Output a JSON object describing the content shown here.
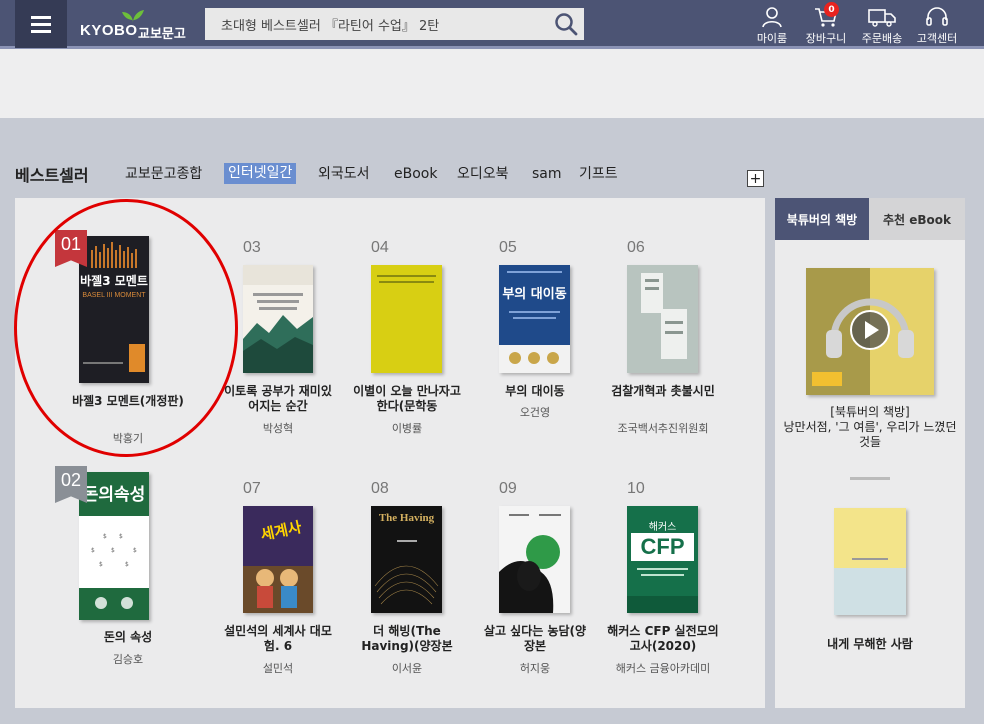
{
  "header": {
    "logo_text": "KYOBO",
    "logo_kr": "교보문고",
    "search_value": "초대형 베스트셀러 『라틴어 수업』 2탄",
    "util": [
      {
        "label": "마이룸",
        "icon": "user-icon"
      },
      {
        "label": "장바구니",
        "icon": "cart-icon",
        "badge": "0"
      },
      {
        "label": "주문배송",
        "icon": "truck-icon"
      },
      {
        "label": "고객센터",
        "icon": "headset-icon"
      }
    ]
  },
  "bestseller": {
    "title": "베스트셀러",
    "tabs": [
      "교보문고종합",
      "인터넷일간",
      "외국도서",
      "eBook",
      "오디오북",
      "sam",
      "기프트"
    ],
    "active_tab": "인터넷일간",
    "plus": "+",
    "books": [
      {
        "rank": "01",
        "title": "바젤3 모멘트(개정판)",
        "author": "박홍기",
        "cover_title": "바젤3 모멘트",
        "cover_sub": "BASEL III MOMENT"
      },
      {
        "rank": "02",
        "title": "돈의 속성",
        "author": "김승호",
        "cover_title": "돈의속성"
      },
      {
        "rank": "03",
        "title": "이토록 공부가 재미있어지는 순간",
        "author": "박성혁"
      },
      {
        "rank": "04",
        "title": "이별이 오늘 만나자고 한다(문학동",
        "author": "이병률"
      },
      {
        "rank": "05",
        "title": "부의 대이동",
        "author": "오건영",
        "cover_title": "부의 대이동"
      },
      {
        "rank": "06",
        "title": "검찰개혁과 촛불시민",
        "author": "조국백서추진위원회"
      },
      {
        "rank": "07",
        "title": "설민석의 세계사 대모험. 6",
        "author": "설민석",
        "cover_title": "세계사"
      },
      {
        "rank": "08",
        "title": "더 해빙(The Having)(양장본",
        "author": "이서윤",
        "cover_title": "The Having"
      },
      {
        "rank": "09",
        "title": "살고 싶다는 농담(양장본",
        "author": "허지웅"
      },
      {
        "rank": "10",
        "title": "해커스 CFP 실전모의고사(2020)",
        "author": "해커스 금융아카데미",
        "cover_title": "CFP",
        "cover_top": "해커스"
      }
    ]
  },
  "side": {
    "tabs": [
      "북튜버의 책방",
      "추천 eBook"
    ],
    "items": [
      {
        "title": "[북튜버의 책방]\n낭만서점, '그 여름', 우리가 느꼈던 것들"
      },
      {
        "title": "내게 무해한 사람"
      }
    ]
  },
  "colors": {
    "header": "#4c5474",
    "active_tab": "#6a8ed0",
    "rank_flag_first": "#c4363c",
    "highlight": "#e00000"
  }
}
